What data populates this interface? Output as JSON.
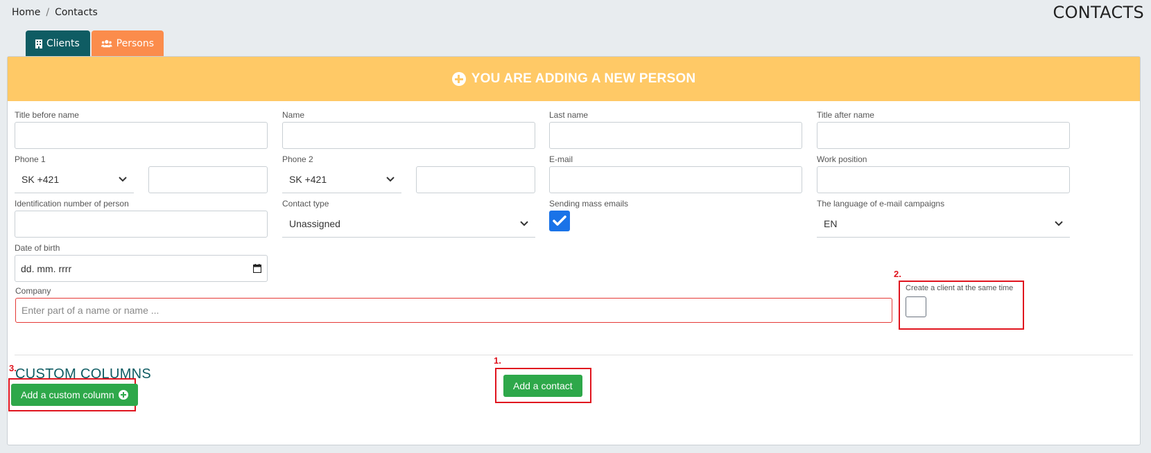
{
  "breadcrumb": {
    "home": "Home",
    "separator": "/",
    "current": "Contacts"
  },
  "page_title": "CONTACTS",
  "tabs": {
    "clients": "Clients",
    "persons": "Persons"
  },
  "header": {
    "title": "YOU ARE ADDING A NEW PERSON"
  },
  "form": {
    "title_before": {
      "label": "Title before name",
      "value": ""
    },
    "name": {
      "label": "Name",
      "value": ""
    },
    "last_name": {
      "label": "Last name",
      "value": ""
    },
    "title_after": {
      "label": "Title after name",
      "value": ""
    },
    "phone1": {
      "label": "Phone 1",
      "prefix": "SK +421",
      "value": ""
    },
    "phone2": {
      "label": "Phone 2",
      "prefix": "SK +421",
      "value": ""
    },
    "email": {
      "label": "E-mail",
      "value": ""
    },
    "work_position": {
      "label": "Work position",
      "value": ""
    },
    "id_number": {
      "label": "Identification number of person",
      "value": ""
    },
    "contact_type": {
      "label": "Contact type",
      "value": "Unassigned"
    },
    "mass_emails": {
      "label": "Sending mass emails",
      "checked": true
    },
    "campaign_language": {
      "label": "The language of e-mail campaigns",
      "value": "EN"
    },
    "date_of_birth": {
      "label": "Date of birth",
      "placeholder": "dd. mm. rrrr"
    },
    "company": {
      "label": "Company",
      "placeholder": "Enter part of a name or name ..."
    },
    "create_client": {
      "label": "Create a client at the same time",
      "checked": false
    }
  },
  "custom_columns": {
    "title": "CUSTOM COLUMNS",
    "add_button": "Add a custom column"
  },
  "add_contact_button": "Add a contact",
  "annotations": {
    "step1": "1.",
    "step2": "2.",
    "step3": "3."
  },
  "colors": {
    "accent_teal": "#0f5c63",
    "orange": "#fb8c4c",
    "header_yellow": "#ffc966",
    "green": "#2ea84a",
    "annotation_red": "#e0141e"
  }
}
